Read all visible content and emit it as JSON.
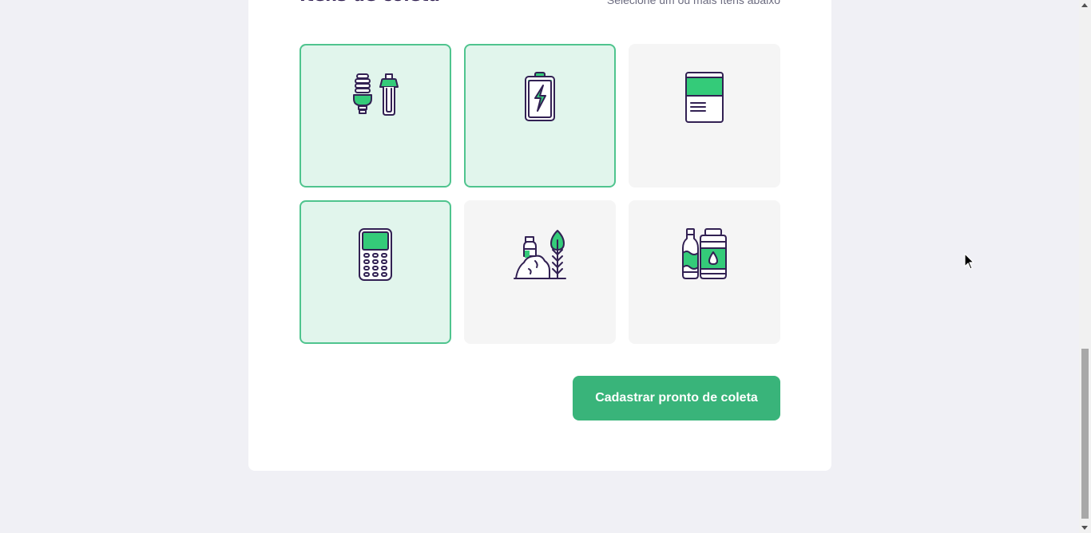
{
  "form": {
    "section_title": "Ítens de coleta",
    "section_hint": "Selecione um ou mais ítens abaixo"
  },
  "items": [
    {
      "icon": "lamp-icon",
      "label": "",
      "selected": true
    },
    {
      "icon": "battery-icon",
      "label": "",
      "selected": true
    },
    {
      "icon": "paper-icon",
      "label": "",
      "selected": false
    },
    {
      "icon": "electronics-icon",
      "label": "",
      "selected": true
    },
    {
      "icon": "organic-waste-icon",
      "label": "",
      "selected": false
    },
    {
      "icon": "oil-bottle-icon",
      "label": "",
      "selected": false
    }
  ],
  "actions": {
    "submit_label": "Cadastrar pronto de coleta"
  },
  "colors": {
    "accent": "#39b47a",
    "selected_background": "#e1f5ec",
    "selected_border": "#4fc48e",
    "title": "#322153",
    "icon_stroke": "#322153",
    "icon_fill": "#34cb79",
    "page_background": "#f0f0f5"
  }
}
